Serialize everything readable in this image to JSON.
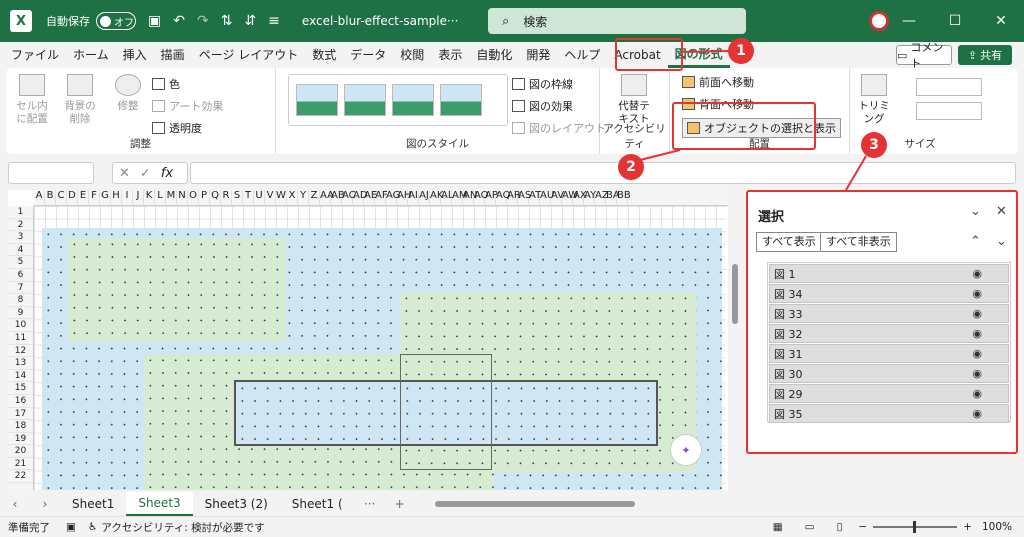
{
  "titlebar": {
    "logo": "X",
    "autosave": "自動保存",
    "toggle": "オフ",
    "filename": "excel-blur-effect-sample···",
    "search": "検索",
    "icons": [
      "save-icon",
      "undo-icon",
      "redo-icon",
      "sort-asc-icon",
      "sort-desc-icon",
      "customize-icon"
    ]
  },
  "window": {
    "minimize": "—",
    "restore": "☐",
    "close": "✕"
  },
  "menu": [
    "ファイル",
    "ホーム",
    "挿入",
    "描画",
    "ページ レイアウト",
    "数式",
    "データ",
    "校閲",
    "表示",
    "自動化",
    "開発",
    "ヘルプ",
    "Acrobat",
    "図の形式"
  ],
  "menu_active": "図の形式",
  "comment": "コメント",
  "share": "共有",
  "ribbon": {
    "adjust": {
      "b1": "セル内に配置",
      "b2": "背景の削除",
      "b3": "修整",
      "color": "色",
      "art": "アート効果",
      "trans": "透明度",
      "label": "調整"
    },
    "styles": {
      "label": "図のスタイル",
      "border": "図の枠線",
      "effect": "図の効果",
      "layout": "図のレイアウト"
    },
    "access": {
      "b": "代替テキスト",
      "label": "アクセシビリティ"
    },
    "arrange": {
      "front": "前面へ移動",
      "back": "背面へ移動",
      "select": "オブジェクトの選択と表示",
      "label": "配置"
    },
    "size": {
      "trim": "トリミング",
      "label": "サイズ"
    }
  },
  "formula": {
    "fx": "fx"
  },
  "columns": [
    "A",
    "B",
    "C",
    "D",
    "E",
    "F",
    "G",
    "H",
    "I",
    "J",
    "K",
    "L",
    "M",
    "N",
    "O",
    "P",
    "Q",
    "R",
    "S",
    "T",
    "U",
    "V",
    "W",
    "X",
    "Y",
    "Z",
    "AA",
    "AB",
    "AC",
    "AD",
    "AE",
    "AF",
    "AG",
    "AH",
    "AI",
    "AJ",
    "AK",
    "AL",
    "AM",
    "AN",
    "AO",
    "AP",
    "AQ",
    "AR",
    "AS",
    "AT",
    "AU",
    "AV",
    "AW",
    "AX",
    "AY",
    "AZ",
    "BA",
    "BB"
  ],
  "rows": [
    "1",
    "2",
    "3",
    "4",
    "5",
    "6",
    "7",
    "8",
    "9",
    "10",
    "11",
    "12",
    "13",
    "14",
    "15",
    "16",
    "17",
    "18",
    "19",
    "20",
    "21",
    "22"
  ],
  "tabs": [
    "Sheet1",
    "Sheet3",
    "Sheet3 (2)",
    "Sheet1 ("
  ],
  "tab_active": "Sheet3",
  "status": {
    "ready": "準備完了",
    "access": "アクセシビリティ: 検討が必要です",
    "zoom": "100%"
  },
  "pane": {
    "title": "選択",
    "show_all": "すべて表示",
    "hide_all": "すべて非表示",
    "items": [
      "図 1",
      "図 34",
      "図 33",
      "図 32",
      "図 31",
      "図 30",
      "図 29",
      "図 35"
    ]
  },
  "callouts": [
    "1",
    "2",
    "3"
  ]
}
